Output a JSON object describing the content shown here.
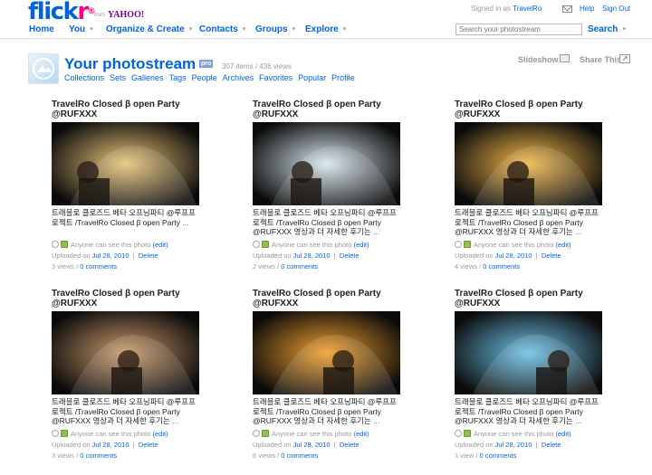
{
  "brand": {
    "logo_flick": "flick",
    "logo_r": "r",
    "logo_mark": "®",
    "from": "from",
    "yahoo": "YAHOO!"
  },
  "top": {
    "signed_prefix": "Signed in as",
    "username": "TravelRo",
    "help": "Help",
    "signout": "Sign Out",
    "mail_icon": "mail-icon"
  },
  "nav": {
    "items": [
      "Home",
      "You",
      "Organize & Create",
      "Contacts",
      "Groups",
      "Explore"
    ],
    "caret": "▾",
    "search_placeholder": "Search your photostream",
    "search_label": "Search"
  },
  "header": {
    "title": "Your photostream",
    "pro": "pro",
    "counts": "307 items / 436 views",
    "subnav": [
      "Collections",
      "Sets",
      "Galleries",
      "Tags",
      "People",
      "Archives",
      "Favorites",
      "Popular",
      "Profile"
    ],
    "slideshow": "Slideshow",
    "share": "Share This"
  },
  "cards": [
    {
      "title": "TravelRo Closed β open Party @RUFXXX",
      "desc": "트래블로 클로즈드 베타 오프닝파티 @루프프로젝트 /TravelRo Closed β open Party",
      "more": "...",
      "privacy": "Anyone can see this photo",
      "edit": "(edit)",
      "uploaded_prefix": "Uploaded on",
      "date": "Jul 28, 2010",
      "delete": "Delete",
      "views": "3 views",
      "comments": "0 comments",
      "accent": "#e9c47a"
    },
    {
      "title": "TravelRo Closed β open Party @RUFXXX",
      "desc": "트래블로 클로즈드 베타 오프닝파티 @루프프로젝트 /TravelRo Closed β open Party @RUFXXX 영상과 더 자세한 후기는",
      "more": "...",
      "privacy": "Anyone can see this photo",
      "edit": "(edit)",
      "uploaded_prefix": "Uploaded on",
      "date": "Jul 28, 2010",
      "delete": "Delete",
      "views": "2 views",
      "comments": "0 comments",
      "accent": "#d8e8f0"
    },
    {
      "title": "TravelRo Closed β open Party @RUFXXX",
      "desc": "트래블로 클로즈드 베타 오프닝파티 @루프프로젝트 /TravelRo Closed β open Party @RUFXXX 영상과 더 자세한 후기는",
      "more": "...",
      "privacy": "Anyone can see this photo",
      "edit": "(edit)",
      "uploaded_prefix": "Uploaded on",
      "date": "Jul 28, 2010",
      "delete": "Delete",
      "views": "4 views",
      "comments": "0 comments",
      "accent": "#f2b84b"
    },
    {
      "title": "TravelRo Closed β open Party @RUFXXX",
      "desc": "트래블로 클로즈드 베타 오프닝파티 @루프프로젝트 /TravelRo Closed β open Party @RUFXXX 영상과 더 자세한 후기는",
      "more": "...",
      "privacy": "Anyone can see this photo",
      "edit": "(edit)",
      "uploaded_prefix": "Uploaded on",
      "date": "Jul 28, 2010",
      "delete": "Delete",
      "views": "3 views",
      "comments": "0 comments",
      "accent": "#c99a6b"
    },
    {
      "title": "TravelRo Closed β open Party @RUFXXX",
      "desc": "트래블로 클로즈드 베타 오프닝파티 @루프프로젝트 /TravelRo Closed β open Party @RUFXXX 영상과 더 자세한 후기는",
      "more": "...",
      "privacy": "Anyone can see this photo",
      "edit": "(edit)",
      "uploaded_prefix": "Uploaded on",
      "date": "Jul 28, 2010",
      "delete": "Delete",
      "views": "6 views",
      "comments": "0 comments",
      "accent": "#f0a030"
    },
    {
      "title": "TravelRo Closed β open Party @RUFXXX",
      "desc": "트래블로 클로즈드 베타 오프닝파티 @루프프로젝트 /TravelRo Closed β open Party @RUFXXX 영상과 더 자세한 후기는",
      "more": "...",
      "privacy": "Anyone can see this photo",
      "edit": "(edit)",
      "uploaded_prefix": "Uploaded on",
      "date": "Jul 28, 2010",
      "delete": "Delete",
      "views": "1 view",
      "comments": "0 comments",
      "accent": "#6ec2e8"
    }
  ],
  "colors": {
    "link": "#0063dc",
    "brand_pink": "#ff0084",
    "muted": "#999999"
  }
}
